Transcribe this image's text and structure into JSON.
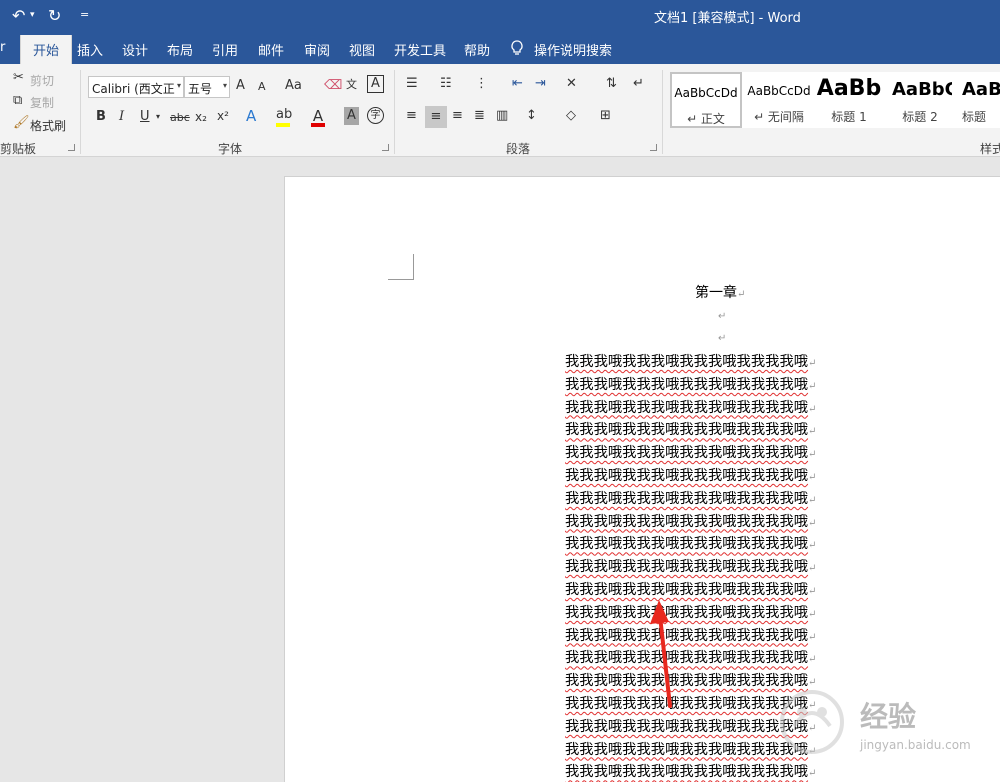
{
  "titlebar": {
    "undo": "↶",
    "undo_drop": "▾",
    "redo": "↻",
    "customize": "=",
    "title": "文档1 [兼容模式]  -  Word"
  },
  "tabs": {
    "file": "r",
    "items": [
      "开始",
      "插入",
      "设计",
      "布局",
      "引用",
      "邮件",
      "审阅",
      "视图",
      "开发工具",
      "帮助"
    ],
    "tellme": "操作说明搜索"
  },
  "clipboard": {
    "cut": "剪切",
    "copy": "复制",
    "format_painter": "格式刷",
    "label": "剪贴板"
  },
  "font": {
    "font_name": "Calibri (西文正",
    "font_size": "五号",
    "grow": "A",
    "shrink": "A",
    "case": "Aa",
    "bold": "B",
    "italic": "I",
    "underline": "U",
    "strike": "abc",
    "sub": "x₂",
    "sup": "x²",
    "label": "字体"
  },
  "paragraph": {
    "label": "段落"
  },
  "styles": {
    "tiles": [
      {
        "sample": "AaBbCcDd",
        "name": "↵ 正文"
      },
      {
        "sample": "AaBbCcDd",
        "name": "↵ 无间隔"
      },
      {
        "sample": "AaBb",
        "name": "标题 1"
      },
      {
        "sample": "AaBbC",
        "name": "标题 2"
      },
      {
        "sample": "AaB",
        "name": "标题"
      }
    ],
    "label": "样式"
  },
  "document": {
    "heading": "第一章",
    "paragraph_mark": "↵",
    "line_text": "我我我哦我我我哦我我我哦我我我我哦",
    "line_count": 19
  },
  "watermark": {
    "text": "经验",
    "url": "jingyan.baidu.com"
  }
}
